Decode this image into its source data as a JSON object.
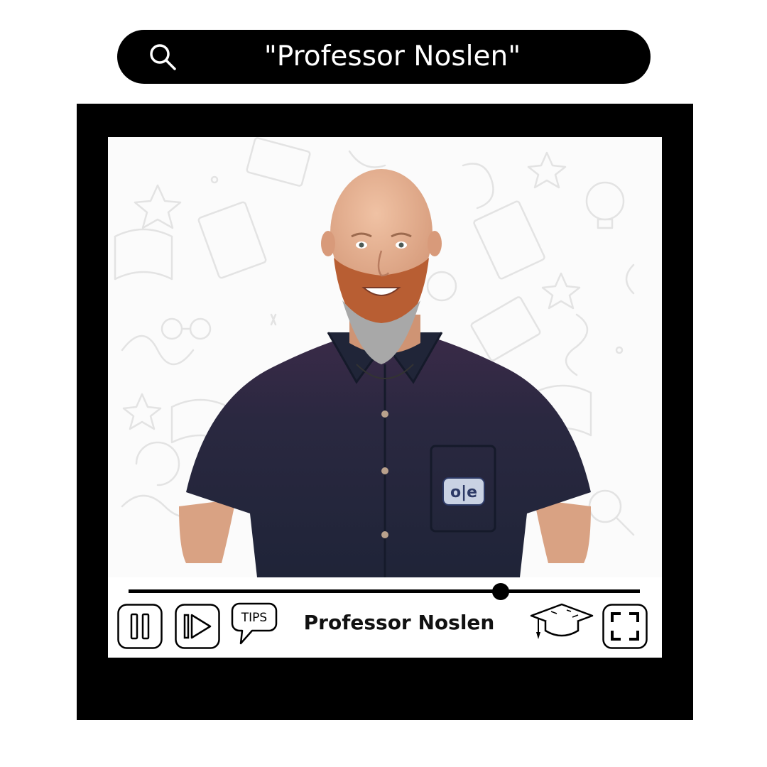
{
  "search": {
    "query": "\"Professor Noslen\"",
    "icon": "search-icon"
  },
  "player": {
    "title": "Professor Noslen",
    "progress": 0.728,
    "shirt_logo": "o|e",
    "controls": {
      "pause_icon": "pause-icon",
      "play_icon": "play-icon",
      "tips_label": "TIPS",
      "cap_icon": "graduation-cap-icon",
      "fullscreen_icon": "fullscreen-icon"
    }
  },
  "colors": {
    "frame": "#000000",
    "shirt": "#1f2438",
    "beard": "#b85e33",
    "skin": "#e0a98a"
  }
}
